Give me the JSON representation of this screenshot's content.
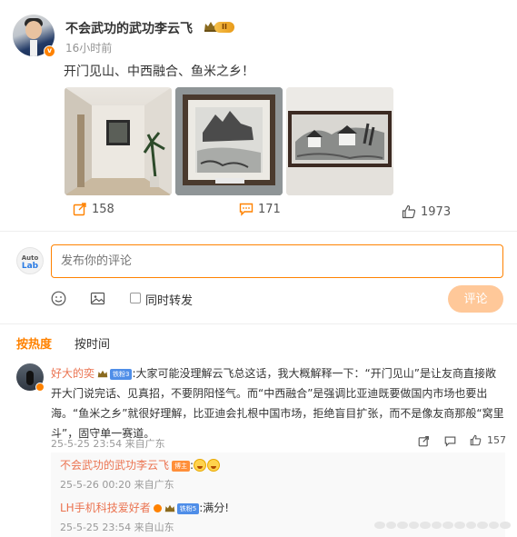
{
  "post": {
    "author": "不会武功的武功李云飞",
    "level_badge": "II",
    "time": "16小时前",
    "text": "开门见山、中西融合、鱼米之乡！",
    "images": [
      "hallway-photo",
      "painting-castle-photo",
      "painting-village-photo"
    ],
    "repost_count": "158",
    "comment_count": "171",
    "like_count": "1973"
  },
  "composer": {
    "avatar_text_top": "Auto",
    "avatar_text_bottom": "Lab",
    "placeholder": "发布你的评论",
    "repost_label": "同时转发",
    "submit_label": "评论"
  },
  "sort": {
    "hot_label": "按热度",
    "time_label": "按时间"
  },
  "comments": [
    {
      "user": "好大的奕",
      "fan_badge": "铁粉3",
      "text": ":大家可能没理解云飞总这话，我大概解释一下：“开门见山”是让友商直接敞开大门说完话、见真招，不要阴阳怪气。而“中西融合”是强调比亚迪既要做国内市场也要出海。“鱼米之乡”就很好理解，比亚迪会扎根中国市场，拒绝盲目扩张，而不是像友商那般“窝里斗”，固守单一赛道。",
      "meta": "25-5-25 23:54 来自广东",
      "like_count": "157",
      "replies": [
        {
          "user": "不会武功的武功李云飞",
          "badge": "博主",
          "text": ":",
          "meta": "25-5-26 00:20 来自广东"
        },
        {
          "user": "LH手机科技爱好者",
          "fan_badge": "铁粉5",
          "text": ":满分!",
          "meta": "25-5-25 23:54 来自山东"
        }
      ]
    }
  ],
  "colors": {
    "accent": "#ff8200",
    "username_link": "#eb7350",
    "submit_disabled": "#ffc899"
  }
}
